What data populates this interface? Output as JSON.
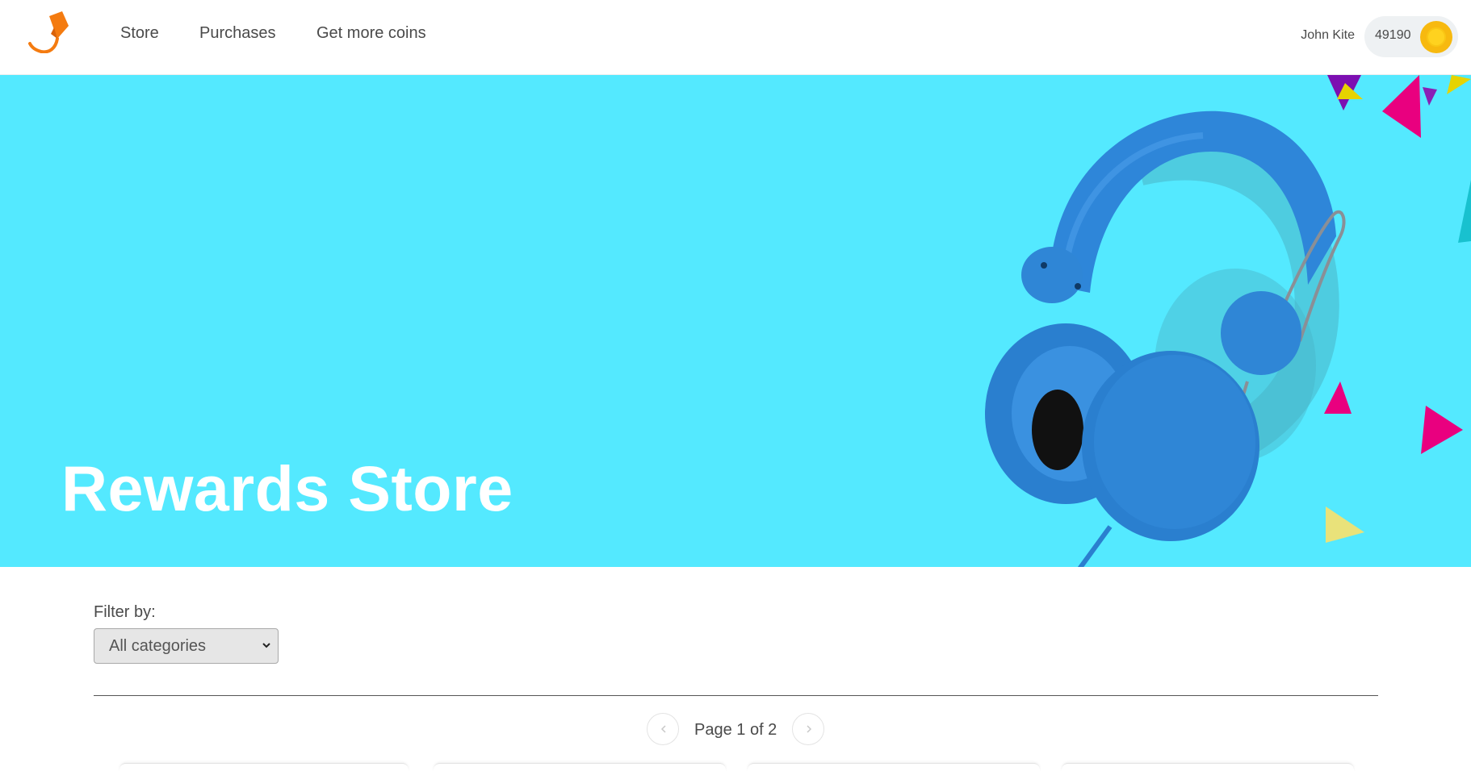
{
  "header": {
    "nav": {
      "store": "Store",
      "purchases": "Purchases",
      "get_more_coins": "Get more coins"
    },
    "user": {
      "name": "John Kite",
      "coins": "49190"
    }
  },
  "hero": {
    "title": "Rewards Store"
  },
  "filter": {
    "label": "Filter by:",
    "selected": "All categories"
  },
  "pagination": {
    "label": "Page 1 of 2"
  },
  "icons": {
    "logo": "logo-icon",
    "coin": "coin-icon",
    "prev": "chevron-left-icon",
    "next": "chevron-right-icon",
    "select": "chevron-down-icon"
  },
  "colors": {
    "hero_background": "#54e9ff",
    "logo_orange": "#f47b10",
    "coin_gold": "#f7b90f",
    "headphones_blue": "#2e86d9"
  }
}
